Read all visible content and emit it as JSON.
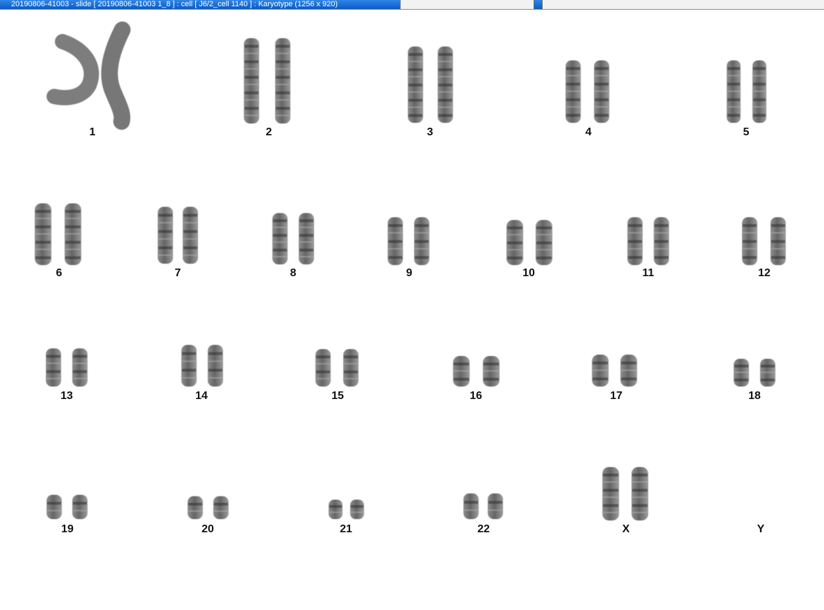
{
  "window": {
    "title": "20190806-41003 - slide [ 20190806-41003 1_8 ] : cell [ J6/2_cell 1140 ] : Karyotype  (1256 x 920)"
  },
  "karyotype": {
    "chromosomes": [
      {
        "label": "1"
      },
      {
        "label": "2"
      },
      {
        "label": "3"
      },
      {
        "label": "4"
      },
      {
        "label": "5"
      },
      {
        "label": "6"
      },
      {
        "label": "7"
      },
      {
        "label": "8"
      },
      {
        "label": "9"
      },
      {
        "label": "10"
      },
      {
        "label": "11"
      },
      {
        "label": "12"
      },
      {
        "label": "13"
      },
      {
        "label": "14"
      },
      {
        "label": "15"
      },
      {
        "label": "16"
      },
      {
        "label": "17"
      },
      {
        "label": "18"
      },
      {
        "label": "19"
      },
      {
        "label": "20"
      },
      {
        "label": "21"
      },
      {
        "label": "22"
      },
      {
        "label": "X"
      },
      {
        "label": "Y"
      }
    ]
  }
}
